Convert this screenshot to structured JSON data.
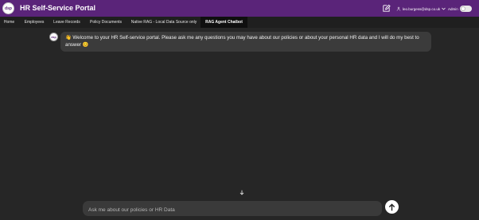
{
  "header": {
    "logo_text": "dsp",
    "title": "HR Self-Service Portal",
    "user_email": "leo.burgess@dsp.co.uk",
    "admin_label": "Admin"
  },
  "nav": {
    "tabs": [
      {
        "label": "Home",
        "active": false
      },
      {
        "label": "Employees",
        "active": false
      },
      {
        "label": "Leave Records",
        "active": false
      },
      {
        "label": "Policy Documents",
        "active": false
      },
      {
        "label": "Native RAG - Local Data Source only",
        "active": false
      },
      {
        "label": "RAG Agent Chatbot",
        "active": true
      }
    ]
  },
  "chat": {
    "avatar_text": "dsp",
    "welcome_message": "👋 Welcome to your HR Self-service portal. Please ask me any questions you may have about our policies or about your personal HR data and I will do my best to answer 😊"
  },
  "composer": {
    "placeholder": "Ask me about our policies or HR Data"
  },
  "colors": {
    "header_bg": "#5a2479",
    "page_bg": "#262626",
    "nav_bg": "#1f1f1f",
    "bubble_bg": "#3b3b3b",
    "input_bg": "#3a3a3a"
  },
  "icons": {
    "edit": "edit-icon",
    "user": "user-icon",
    "chevron": "chevron-down-icon",
    "scroll": "arrow-down-icon",
    "send": "arrow-up-icon"
  }
}
